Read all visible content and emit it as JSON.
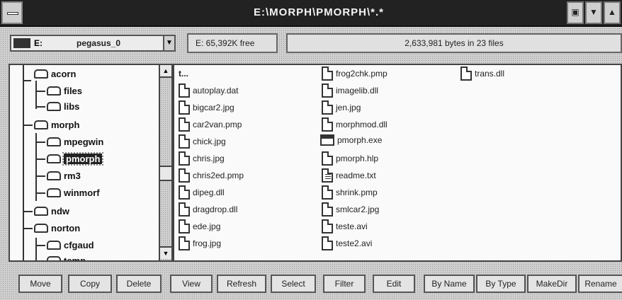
{
  "window": {
    "title": "E:\\MORPH\\PMORPH\\*.*"
  },
  "drive": {
    "letter": "E:",
    "volume": "pegasus_0",
    "free": "E: 65,392K free",
    "bytes_info": "2,633,981 bytes in 23 files"
  },
  "tree": {
    "items": [
      {
        "label": "acorn"
      },
      {
        "label": "files"
      },
      {
        "label": "libs"
      },
      {
        "label": "morph"
      },
      {
        "label": "mpegwin"
      },
      {
        "label": "pmorph"
      },
      {
        "label": "rm3"
      },
      {
        "label": "winmorf"
      },
      {
        "label": "ndw"
      },
      {
        "label": "norton"
      },
      {
        "label": "cfgaud"
      },
      {
        "label": "temp"
      }
    ]
  },
  "files": {
    "up": "t...",
    "items": [
      {
        "name": "autoplay.dat",
        "icon": "document-icon"
      },
      {
        "name": "bigcar2.jpg",
        "icon": "document-icon"
      },
      {
        "name": "car2van.pmp",
        "icon": "document-icon"
      },
      {
        "name": "chick.jpg",
        "icon": "document-icon"
      },
      {
        "name": "chris.jpg",
        "icon": "document-icon"
      },
      {
        "name": "chris2ed.pmp",
        "icon": "document-icon"
      },
      {
        "name": "dipeg.dll",
        "icon": "document-icon"
      },
      {
        "name": "dragdrop.dll",
        "icon": "document-icon"
      },
      {
        "name": "ede.jpg",
        "icon": "document-icon"
      },
      {
        "name": "frog.jpg",
        "icon": "document-icon"
      },
      {
        "name": "frog2chk.pmp",
        "icon": "document-icon"
      },
      {
        "name": "imagelib.dll",
        "icon": "document-icon"
      },
      {
        "name": "jen.jpg",
        "icon": "document-icon"
      },
      {
        "name": "morphmod.dll",
        "icon": "document-icon"
      },
      {
        "name": "pmorph.exe",
        "icon": "exe-icon"
      },
      {
        "name": "pmorph.hlp",
        "icon": "document-icon"
      },
      {
        "name": "readme.txt",
        "icon": "text-file-icon"
      },
      {
        "name": "shrink.pmp",
        "icon": "document-icon"
      },
      {
        "name": "smlcar2.jpg",
        "icon": "document-icon"
      },
      {
        "name": "teste.avi",
        "icon": "document-icon"
      },
      {
        "name": "teste2.avi",
        "icon": "document-icon"
      },
      {
        "name": "trans.dll",
        "icon": "document-icon"
      }
    ]
  },
  "toolbar": {
    "move": "Move",
    "copy": "Copy",
    "delete": "Delete",
    "view": "View",
    "refresh": "Refresh",
    "select": "Select",
    "filter": "Filter",
    "edit": "Edit",
    "by_name": "By Name",
    "by_type": "By Type",
    "make_dir": "MakeDir",
    "rename": "Rename"
  }
}
